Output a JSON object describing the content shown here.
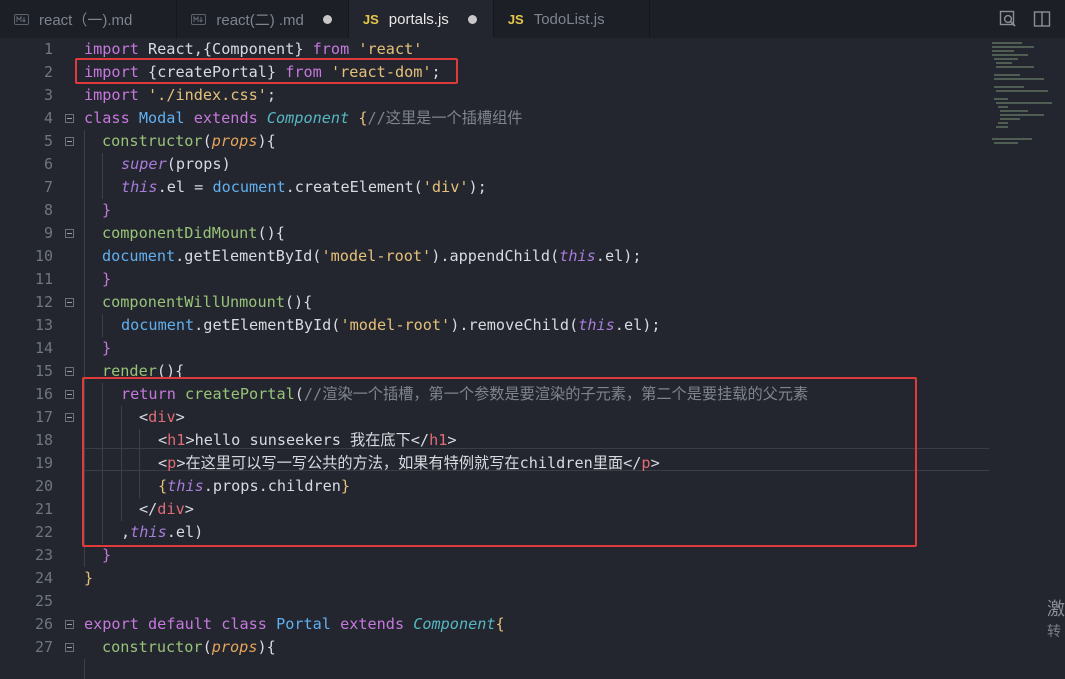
{
  "tabs": [
    {
      "icon": "markdown-icon",
      "label": "react（一).md",
      "state": "clean"
    },
    {
      "icon": "markdown-icon",
      "label": "react(二) .md",
      "state": "modified"
    },
    {
      "icon": "javascript-icon",
      "icon_text": "JS",
      "label": "portals.js",
      "state": "modified"
    },
    {
      "icon": "javascript-icon",
      "icon_text": "JS",
      "label": "TodoList.js",
      "state": "clean"
    }
  ],
  "toolbar": {
    "icons": [
      "open-preview-icon",
      "split-editor-icon"
    ]
  },
  "gutter": {
    "line_numbers": [
      "1",
      "2",
      "3",
      "4",
      "5",
      "6",
      "7",
      "8",
      "9",
      "10",
      "11",
      "12",
      "13",
      "14",
      "15",
      "16",
      "17",
      "18",
      "19",
      "20",
      "21",
      "22",
      "23",
      "24",
      "25",
      "26",
      "27"
    ]
  },
  "code": {
    "l1": {
      "a": "import",
      "b": " React,",
      "c": "{",
      "d": "Component",
      "e": "}",
      "f": " from ",
      "g": "'react'"
    },
    "l2": {
      "a": "import",
      "b": " ",
      "c": "{",
      "d": "createPortal",
      "e": "}",
      "f": " from ",
      "g": "'react-dom'",
      "h": ";"
    },
    "l3": {
      "a": "import",
      "b": " ",
      "c": "'./index.css'",
      "d": ";"
    },
    "l4": {
      "a": "class",
      "b": " Modal ",
      "c": "extends",
      "d": " Component ",
      "e": "{",
      "f": "//这里是一个插槽组件"
    },
    "l5": {
      "a": "constructor",
      "b": "(",
      "c": "props",
      "d": "){"
    },
    "l6": {
      "a": "super",
      "b": "(props)"
    },
    "l7": {
      "a": "this",
      "b": ".el = ",
      "c": "document",
      "d": ".createElement(",
      "e": "'div'",
      "f": ");"
    },
    "l8": {
      "a": "}"
    },
    "l9": {
      "a": "componentDidMount",
      "b": "(){"
    },
    "l10": {
      "a": "document",
      "b": ".getElementById(",
      "c": "'model-root'",
      "d": ").appendChild(",
      "e": "this",
      "f": ".el);"
    },
    "l11": {
      "a": "}"
    },
    "l12": {
      "a": "componentWillUnmount",
      "b": "(){"
    },
    "l13": {
      "a": "document",
      "b": ".getElementById(",
      "c": "'model-root'",
      "d": ").removeChild(",
      "e": "this",
      "f": ".el);"
    },
    "l14": {
      "a": "}"
    },
    "l15": {
      "a": "render",
      "b": "(){"
    },
    "l16": {
      "a": "return",
      "b": " createPortal",
      "c": "(",
      "d": "//渲染一个插槽，第一个参数是要渲染的子元素，第二个是要挂载的父元素"
    },
    "l17": {
      "a": "<",
      "b": "div",
      "c": ">"
    },
    "l18": {
      "a": "<",
      "b": "h1",
      "c": ">hello sunseekers 我在底下</",
      "d": "h1",
      "e": ">"
    },
    "l19": {
      "a": "<",
      "b": "p",
      "c": ">在这里可以写一写公共的方法，如果有特例就写在children里面</",
      "d": "p",
      "e": ">"
    },
    "l20": {
      "a": "{",
      "b": "this",
      "c": ".props.children",
      "d": "}"
    },
    "l21": {
      "a": "</",
      "b": "div",
      "c": ">"
    },
    "l22": {
      "a": ",",
      "b": "this",
      "c": ".el)"
    },
    "l23": {
      "a": "}"
    },
    "l24": {
      "a": "}"
    },
    "l26": {
      "a": "export",
      "b": " ",
      "c": "default",
      "d": " ",
      "e": "class",
      "f": " Portal ",
      "g": "extends",
      "h": " Component",
      "i": "{"
    },
    "l27": {
      "a": "constructor",
      "b": "(",
      "c": "props",
      "d": "){"
    }
  },
  "watermark": {
    "line1": "激",
    "line2": "转"
  }
}
